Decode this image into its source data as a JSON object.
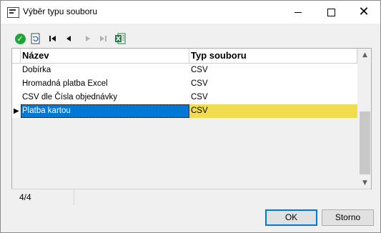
{
  "window": {
    "title": "Výběr typu souboru"
  },
  "toolbar": {
    "buttons": [
      {
        "name": "confirm-icon"
      },
      {
        "name": "refresh-icon"
      },
      {
        "name": "first-record-icon"
      },
      {
        "name": "previous-record-icon"
      },
      {
        "name": "next-record-icon"
      },
      {
        "name": "last-record-icon"
      },
      {
        "name": "excel-export-icon"
      }
    ]
  },
  "grid": {
    "columns": [
      "Název",
      "Typ souboru"
    ],
    "rows": [
      {
        "name": "Dobírka",
        "type": "CSV"
      },
      {
        "name": "Hromadná platba Excel",
        "type": "CSV"
      },
      {
        "name": "CSV dle Čísla objednávky",
        "type": "CSV"
      },
      {
        "name": "Platba kartou",
        "type": "CSV",
        "selected": true
      }
    ],
    "current_row_marker": "▶"
  },
  "status": {
    "record_count": "4/4"
  },
  "buttons": {
    "ok": "OK",
    "cancel": "Storno"
  },
  "colors": {
    "selection_blue": "#0078d7",
    "selection_yellow": "#f0dc4c",
    "accent_green": "#1fa43a"
  }
}
